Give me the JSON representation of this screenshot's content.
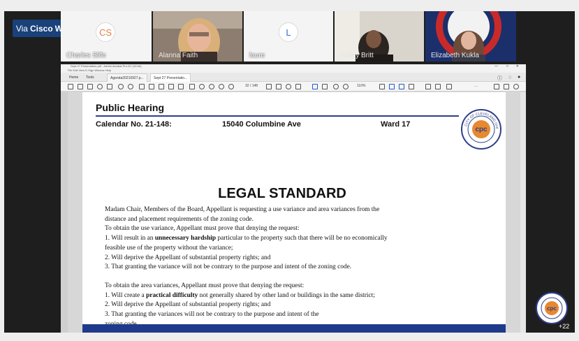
{
  "webex": {
    "prefix": "Via",
    "brand_a": "Cisco",
    "brand_b": "Webex"
  },
  "participants": [
    {
      "name": "Charles Slife",
      "initials": "CS",
      "initials_color": "#e67e42"
    },
    {
      "name": "Alanna Faith"
    },
    {
      "name": "laure",
      "initials": "L",
      "initials_color": "#3d6fcf"
    },
    {
      "name": "Kelley Britt"
    },
    {
      "name": "Elizabeth Kukla"
    }
  ],
  "more_participants": "+22",
  "acrobat": {
    "title": "Sept 27 Presentation.pdf - Adobe Acrobat Pro DC (32-bit)",
    "menu": "File  Edit  View  E-Sign  Window  Help",
    "nav_home": "Home",
    "nav_tools": "Tools",
    "tabs": [
      "Agenda20210927.p...",
      "Sept 27 Presentatio..."
    ],
    "page_indicator": "32 / 148",
    "zoom": "110%"
  },
  "slide": {
    "heading": "Public Hearing",
    "calendar": "Calendar No. 21-148:",
    "address": "15040 Columbine Ave",
    "ward": "Ward 17",
    "seal_text": "CITY OF CLEVELAND OHIO",
    "seal_center": "cpc",
    "title": "LEGAL STANDARD",
    "lines": [
      "Madam Chair, Members of the Board, Appellant is requesting a use variance and area variances from the",
      "distance and placement requirements of the zoning code.",
      "To obtain the use variance, Appellant must prove that denying the request:"
    ],
    "use_item1_pre": "1. Will result in an ",
    "use_item1_bold": "unnecessary hardship",
    "use_item1_post": " particular to the property such that there will be no economically",
    "use_item1_cont": "feasible use of the property without the variance;",
    "use_item2": "2. Will deprive the Appellant of substantial property rights; and",
    "use_item3": "3. That granting the variance will not be contrary to the purpose and intent of the zoning code.",
    "area_intro": "To obtain the area variances, Appellant must prove that denying the request:",
    "area_item1_pre": "1. Will create a ",
    "area_item1_bold": "practical difficulty",
    "area_item1_post": " not generally shared by other land or buildings in the same district;",
    "area_item2": "2. Will deprive the Appellant of substantial property rights; and",
    "area_item3": "3. That granting the variances will not be contrary to the purpose and intent of the",
    "area_item3_cont": "zoning code."
  },
  "colors": {
    "slide_blue": "#2e3f88",
    "webex_badge": "#19417a",
    "seal_orange": "#e8882f"
  }
}
